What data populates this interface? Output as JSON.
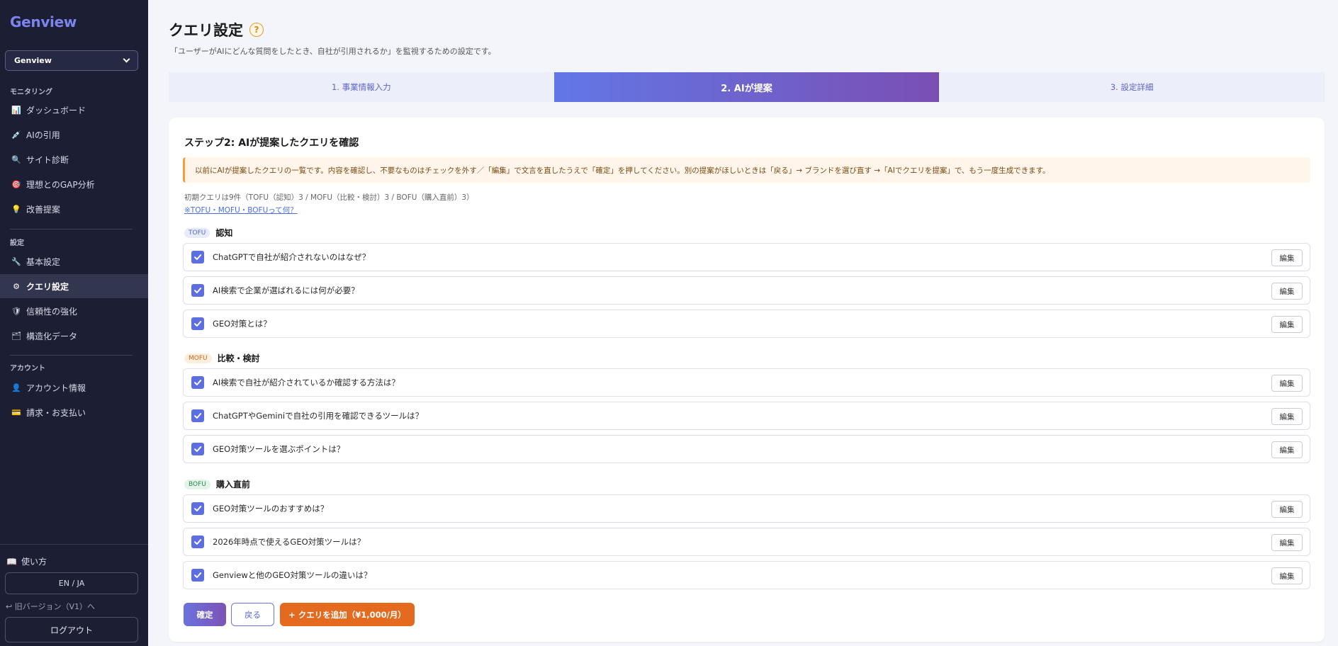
{
  "app": {
    "logo": "Genview",
    "org_select": "Genview"
  },
  "sidebar": {
    "sections": [
      {
        "title": "モニタリング",
        "items": [
          {
            "icon": "📊",
            "label": "ダッシュボード"
          },
          {
            "icon": "💉",
            "label": "AIの引用"
          },
          {
            "icon": "🔍",
            "label": "サイト診断"
          },
          {
            "icon": "🎯",
            "label": "理想とのGAP分析"
          },
          {
            "icon": "💡",
            "label": "改善提案"
          }
        ]
      },
      {
        "title": "設定",
        "items": [
          {
            "icon": "🔧",
            "label": "基本設定"
          },
          {
            "icon": "⚙",
            "label": "クエリ設定"
          },
          {
            "icon": "🛡",
            "label": "信頼性の強化"
          },
          {
            "icon": "🗂",
            "label": "構造化データ"
          }
        ]
      },
      {
        "title": "アカウント",
        "items": [
          {
            "icon": "👤",
            "label": "アカウント情報"
          },
          {
            "icon": "💳",
            "label": "請求・お支払い"
          }
        ]
      }
    ],
    "active_item": "クエリ設定",
    "howto": {
      "icon": "📖",
      "label": "使い方"
    },
    "lang_toggle": "EN / JA",
    "old_version": "↩ 旧バージョン（V1）へ",
    "logout": "ログアウト"
  },
  "page": {
    "title": "クエリ設定",
    "help": "?",
    "description": "「ユーザーがAIにどんな質問をしたとき、自社が引用されるか」を監視するための設定です。"
  },
  "steps": [
    {
      "label": "1. 事業情報入力",
      "active": false
    },
    {
      "label": "2. AIが提案",
      "active": true
    },
    {
      "label": "3. 設定詳細",
      "active": false
    }
  ],
  "card": {
    "title": "ステップ2: AIが提案したクエリを確認",
    "notice": "以前にAIが提案したクエリの一覧です。内容を確認し、不要なものはチェックを外す／「編集」で文言を直したうえで「確定」を押してください。別の提案がほしいときは「戻る」→ ブランドを選び直す →「AIでクエリを提案」で、もう一度生成できます。",
    "init_info": "初期クエリは9件（TOFU（認知）3 / MOFU（比較・検討）3 / BOFU（購入直前）3）",
    "faq_link": "※TOFU・MOFU・BOFUって何？"
  },
  "groups": [
    {
      "badge": "TOFU",
      "label": "認知",
      "queries": [
        {
          "text": "ChatGPTで自社が紹介されないのはなぜ？",
          "checked": true
        },
        {
          "text": "AI検索で企業が選ばれるには何が必要？",
          "checked": true
        },
        {
          "text": "GEO対策とは？",
          "checked": true
        }
      ]
    },
    {
      "badge": "MOFU",
      "label": "比較・検討",
      "queries": [
        {
          "text": "AI検索で自社が紹介されているか確認する方法は？",
          "checked": true
        },
        {
          "text": "ChatGPTやGeminiで自社の引用を確認できるツールは？",
          "checked": true
        },
        {
          "text": "GEO対策ツールを選ぶポイントは？",
          "checked": true
        }
      ]
    },
    {
      "badge": "BOFU",
      "label": "購入直前",
      "queries": [
        {
          "text": "GEO対策ツールのおすすめは？",
          "checked": true
        },
        {
          "text": "2026年時点で使えるGEO対策ツールは？",
          "checked": true
        },
        {
          "text": "Genviewと他のGEO対策ツールの違いは？",
          "checked": true
        }
      ]
    }
  ],
  "edit_label": "編集",
  "actions": {
    "confirm": "確定",
    "back": "戻る",
    "add_query": "+ クエリを追加（¥1,000/月）"
  },
  "colors": {
    "sidebar_bg": "#1c1e33",
    "accent": "#5d6fe0",
    "orange": "#e36a1e"
  }
}
